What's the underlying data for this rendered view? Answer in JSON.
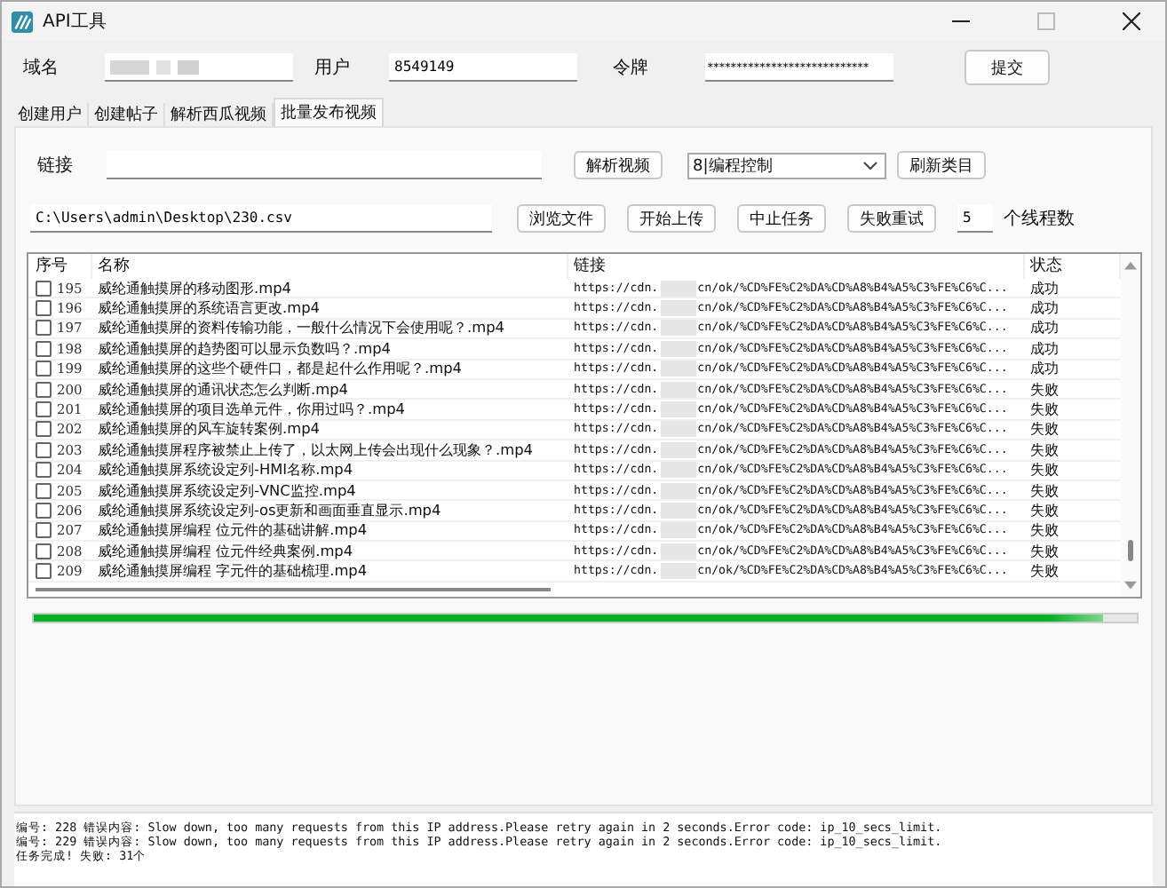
{
  "window": {
    "title": "API工具"
  },
  "login": {
    "domain_label": "域名",
    "user_label": "用户",
    "user_value": "8549149",
    "token_label": "令牌",
    "token_value": "****************************",
    "submit": "提交"
  },
  "tabs": [
    {
      "label": "创建用户",
      "selected": false
    },
    {
      "label": "创建帖子",
      "selected": false
    },
    {
      "label": "解析西瓜视频",
      "selected": false
    },
    {
      "label": "批量发布视频",
      "selected": true
    }
  ],
  "link_row": {
    "label": "链接",
    "parse_button": "解析视频",
    "category": "8|编程控制",
    "refresh_button": "刷新类目"
  },
  "file_row": {
    "path": "C:\\Users\\admin\\Desktop\\230.csv",
    "buttons": [
      "浏览文件",
      "开始上传",
      "中止任务",
      "失败重试"
    ],
    "threads": "5",
    "threads_label": "个线程数"
  },
  "table": {
    "columns": [
      "序号",
      "名称",
      "链接",
      "状态"
    ],
    "rows": [
      {
        "id": "195",
        "checked": false,
        "name": "威纶通触摸屏的移动图形.mp4",
        "link_start": "https://cdn.",
        "link_end": "cn/ok/%CD%FE%C2%DA%CD%A8%B4%A5%C3%FE%C6%C...",
        "status": "成功"
      },
      {
        "id": "196",
        "checked": false,
        "name": "威纶通触摸屏的系统语言更改.mp4",
        "link_start": "https://cdn.",
        "link_end": "cn/ok/%CD%FE%C2%DA%CD%A8%B4%A5%C3%FE%C6%C...",
        "status": "成功"
      },
      {
        "id": "197",
        "checked": false,
        "name": "威纶通触摸屏的资料传输功能，一般什么情况下会使用呢？.mp4",
        "link_start": "https://cdn.",
        "link_end": "cn/ok/%CD%FE%C2%DA%CD%A8%B4%A5%C3%FE%C6%C...",
        "status": "成功"
      },
      {
        "id": "198",
        "checked": false,
        "name": "威纶通触摸屏的趋势图可以显示负数吗？.mp4",
        "link_start": "https://cdn.",
        "link_end": "cn/ok/%CD%FE%C2%DA%CD%A8%B4%A5%C3%FE%C6%C...",
        "status": "成功"
      },
      {
        "id": "199",
        "checked": false,
        "name": "威纶通触摸屏的这些个硬件口，都是起什么作用呢？.mp4",
        "link_start": "https://cdn.",
        "link_end": "cn/ok/%CD%FE%C2%DA%CD%A8%B4%A5%C3%FE%C6%C...",
        "status": "成功"
      },
      {
        "id": "200",
        "checked": false,
        "name": "威纶通触摸屏的通讯状态怎么判断.mp4",
        "link_start": "https://cdn.",
        "link_end": "cn/ok/%CD%FE%C2%DA%CD%A8%B4%A5%C3%FE%C6%C...",
        "status": "失败"
      },
      {
        "id": "201",
        "checked": false,
        "name": "威纶通触摸屏的项目选单元件，你用过吗？.mp4",
        "link_start": "https://cdn.",
        "link_end": "cn/ok/%CD%FE%C2%DA%CD%A8%B4%A5%C3%FE%C6%C...",
        "status": "失败"
      },
      {
        "id": "202",
        "checked": false,
        "name": "威纶通触摸屏的风车旋转案例.mp4",
        "link_start": "https://cdn.",
        "link_end": "cn/ok/%CD%FE%C2%DA%CD%A8%B4%A5%C3%FE%C6%C...",
        "status": "失败"
      },
      {
        "id": "203",
        "checked": false,
        "name": "威纶通触摸屏程序被禁止上传了，以太网上传会出现什么现象？.mp4",
        "link_start": "https://cdn.",
        "link_end": "cn/ok/%CD%FE%C2%DA%CD%A8%B4%A5%C3%FE%C6%C...",
        "status": "失败"
      },
      {
        "id": "204",
        "checked": false,
        "name": "威纶通触摸屏系统设定列-HMI名称.mp4",
        "link_start": "https://cdn.",
        "link_end": "cn/ok/%CD%FE%C2%DA%CD%A8%B4%A5%C3%FE%C6%C...",
        "status": "失败"
      },
      {
        "id": "205",
        "checked": false,
        "name": "威纶通触摸屏系统设定列-VNC监控.mp4",
        "link_start": "https://cdn.",
        "link_end": "cn/ok/%CD%FE%C2%DA%CD%A8%B4%A5%C3%FE%C6%C...",
        "status": "失败"
      },
      {
        "id": "206",
        "checked": false,
        "name": "威纶通触摸屏系统设定列-os更新和画面垂直显示.mp4",
        "link_start": "https://cdn.",
        "link_end": "cn/ok/%CD%FE%C2%DA%CD%A8%B4%A5%C3%FE%C6%C...",
        "status": "失败"
      },
      {
        "id": "207",
        "checked": false,
        "name": "威纶通触摸屏编程 位元件的基础讲解.mp4",
        "link_start": "https://cdn.",
        "link_end": "cn/ok/%CD%FE%C2%DA%CD%A8%B4%A5%C3%FE%C6%C...",
        "status": "失败"
      },
      {
        "id": "208",
        "checked": false,
        "name": "威纶通触摸屏编程 位元件经典案例.mp4",
        "link_start": "https://cdn.",
        "link_end": "cn/ok/%CD%FE%C2%DA%CD%A8%B4%A5%C3%FE%C6%C...",
        "status": "失败"
      },
      {
        "id": "209",
        "checked": false,
        "name": "威纶通触摸屏编程 字元件的基础梳理.mp4",
        "link_start": "https://cdn.",
        "link_end": "cn/ok/%CD%FE%C2%DA%CD%A8%B4%A5%C3%FE%C6%C...",
        "status": "失败"
      }
    ]
  },
  "progress": {
    "level": 0.97
  },
  "log": [
    "编号: 228 错误内容: Slow down, too many requests from this IP address.Please retry again in 2 seconds.Error code: ip_10_secs_limit.",
    "编号: 229 错误内容: Slow down, too many requests from this IP address.Please retry again in 2 seconds.Error code: ip_10_secs_limit.",
    "任务完成! 失败: 31个"
  ]
}
